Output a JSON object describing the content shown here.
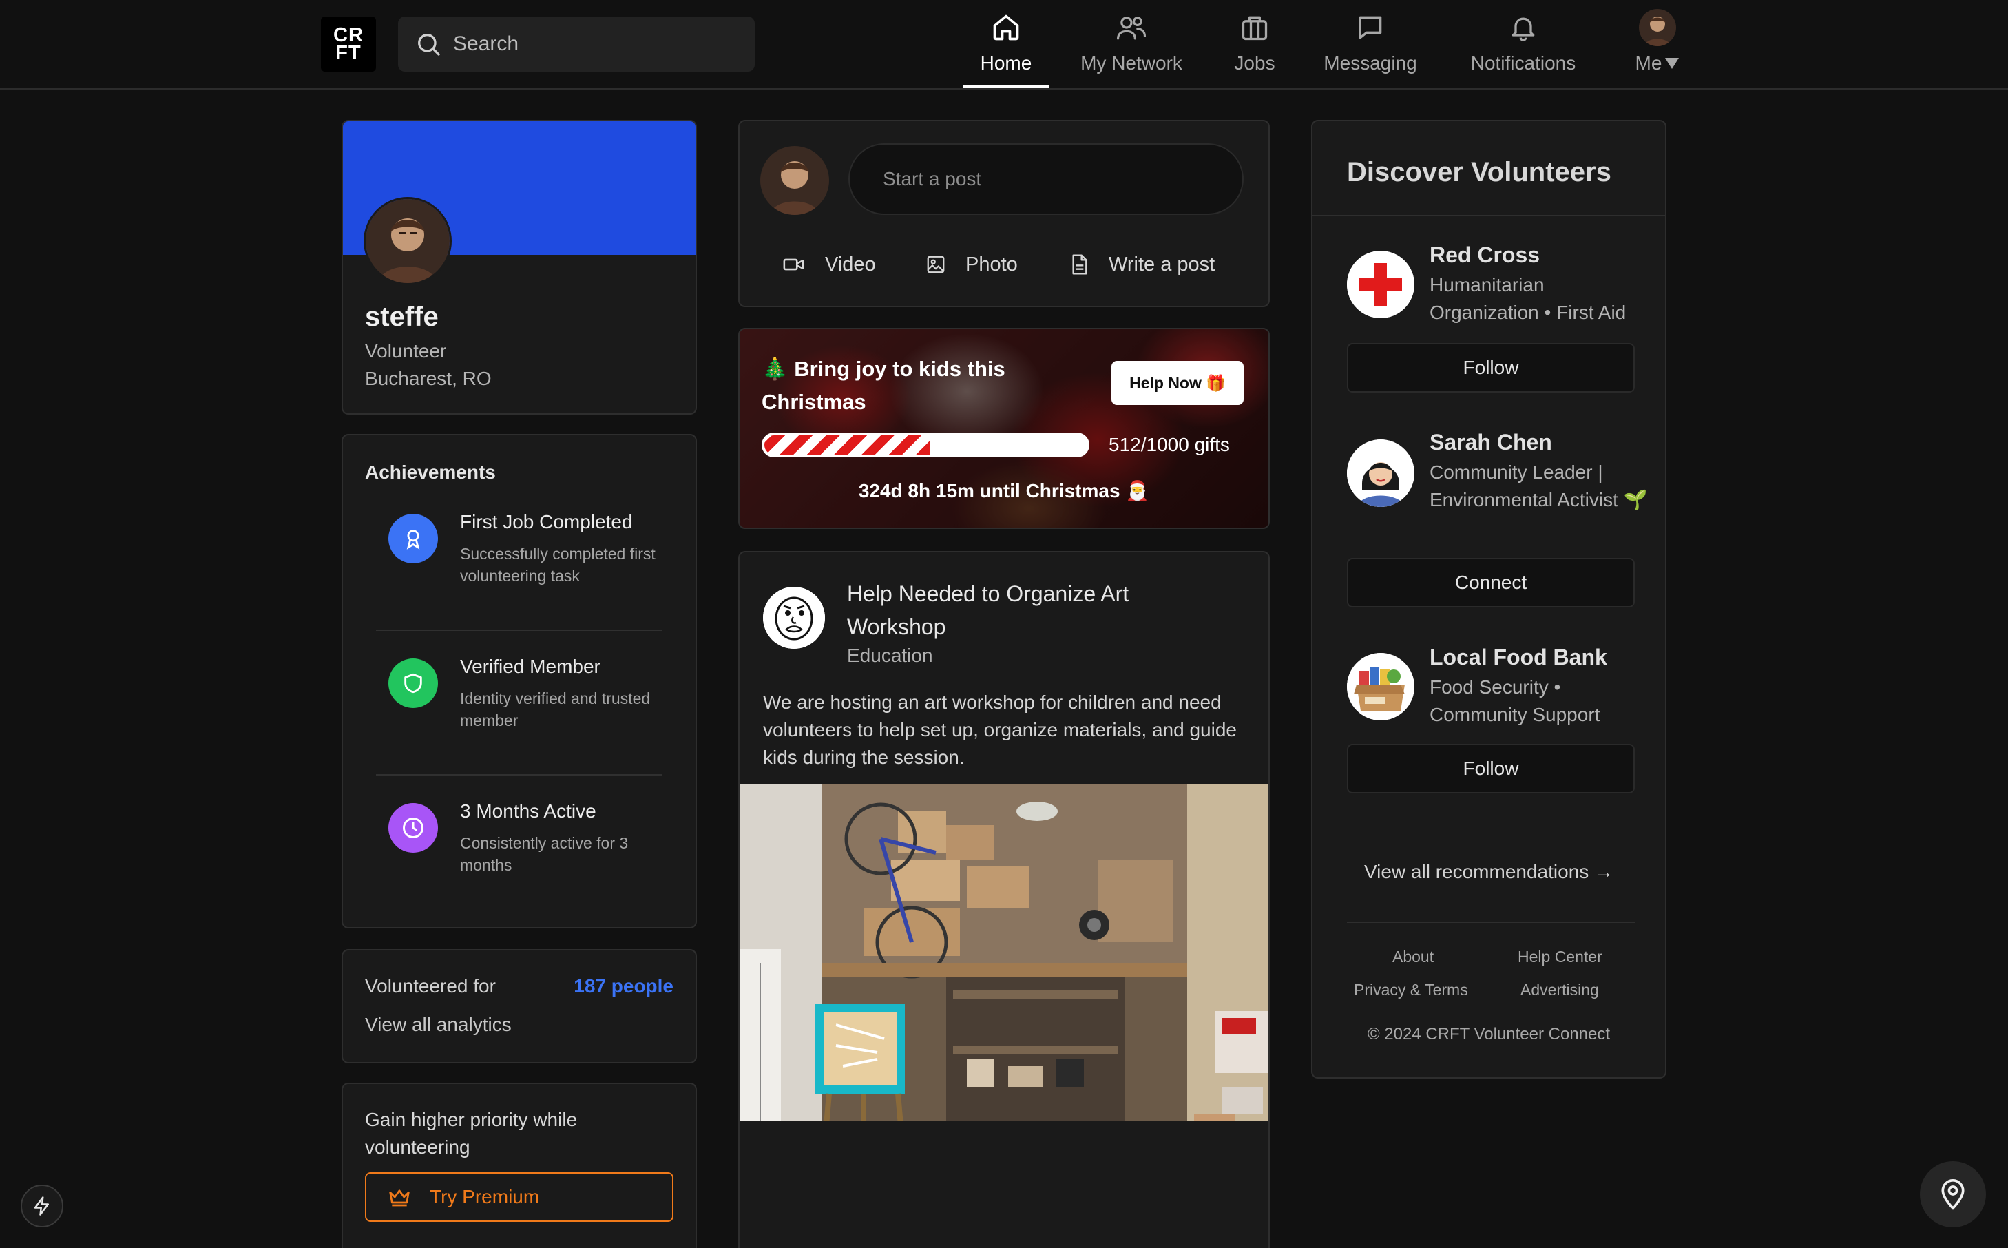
{
  "app": {
    "logo_line1": "CR",
    "logo_line2": "FT",
    "accent_color": "#3b73f5",
    "premium_color": "#f07a1a"
  },
  "search": {
    "placeholder": "Search"
  },
  "nav": {
    "home": "Home",
    "network": "My Network",
    "jobs": "Jobs",
    "messaging": "Messaging",
    "notifications": "Notifications",
    "me": "Me",
    "active": "Home"
  },
  "profile": {
    "name": "steffe",
    "role": "Volunteer",
    "location": "Bucharest, RO"
  },
  "achievements": {
    "title": "Achievements",
    "items": [
      {
        "name": "First Job Completed",
        "desc": "Successfully completed first volunteering task",
        "icon": "ribbon-icon",
        "color": "#3b73f5"
      },
      {
        "name": "Verified Member",
        "desc": "Identity verified and trusted member",
        "icon": "shield-icon",
        "color": "#22c55e"
      },
      {
        "name": "3 Months Active",
        "desc": "Consistently active for 3 months",
        "icon": "clock-icon",
        "color": "#a855f7"
      }
    ]
  },
  "volunteered": {
    "label": "Volunteered for",
    "count": "187 people",
    "analytics": "View all analytics"
  },
  "premium": {
    "text": "Gain higher priority while volunteering",
    "button": "Try Premium"
  },
  "composer": {
    "placeholder": "Start a post",
    "video": "Video",
    "photo": "Photo",
    "write": "Write a post"
  },
  "christmas": {
    "title": "🎄 Bring joy to kids this Christmas",
    "button": "Help Now 🎁",
    "progress_current": 512,
    "progress_total": 1000,
    "progress_label": "512/1000 gifts",
    "countdown": "324d 8h 15m until Christmas 🎅"
  },
  "post": {
    "title": "Help Needed to Organize Art Workshop",
    "category": "Education",
    "body": "We are hosting an art workshop for children and need volunteers to help set up, organize materials, and guide kids during the session."
  },
  "discover": {
    "title": "Discover Volunteers",
    "recommendations": [
      {
        "name": "Red Cross",
        "desc": "Humanitarian Organization • First Aid",
        "button": "Follow",
        "icon": "red-cross-logo"
      },
      {
        "name": "Sarah Chen",
        "desc": "Community Leader | Environmental Activist 🌱",
        "button": "Connect",
        "icon": "person-avatar"
      },
      {
        "name": "Local Food Bank",
        "desc": "Food Security • Community Support",
        "button": "Follow",
        "icon": "donation-box-logo"
      }
    ],
    "view_all": "View all recommendations →"
  },
  "footer": {
    "about": "About",
    "help": "Help Center",
    "privacy": "Privacy & Terms",
    "advertising": "Advertising",
    "copyright": "© 2024 CRFT Volunteer Connect"
  }
}
